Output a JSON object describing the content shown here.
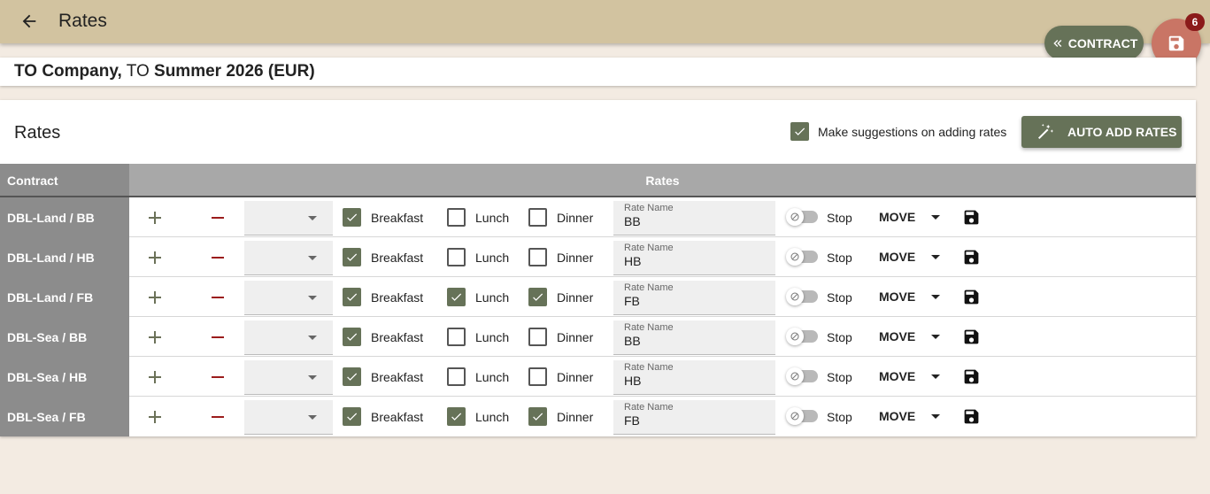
{
  "header": {
    "title": "Rates"
  },
  "fab": {
    "contract_label": "CONTRACT",
    "badge": "6"
  },
  "contract": {
    "company": "TO Company,",
    "prefix": "TO",
    "season": "Summer 2026 (EUR)"
  },
  "rates": {
    "heading": "Rates",
    "suggestions_label": "Make suggestions on adding rates",
    "suggestions_checked": true,
    "auto_add_label": "AUTO ADD RATES",
    "col_contract": "Contract",
    "col_rates": "Rates",
    "meal_labels": {
      "breakfast": "Breakfast",
      "lunch": "Lunch",
      "dinner": "Dinner"
    },
    "rate_name_label": "Rate Name",
    "stop_label": "Stop",
    "move_label": "MOVE",
    "rows": [
      {
        "label": "DBL-Land / BB",
        "breakfast": true,
        "lunch": false,
        "dinner": false,
        "rate_name": "BB",
        "stop": false
      },
      {
        "label": "DBL-Land / HB",
        "breakfast": true,
        "lunch": false,
        "dinner": false,
        "rate_name": "HB",
        "stop": false
      },
      {
        "label": "DBL-Land / FB",
        "breakfast": true,
        "lunch": true,
        "dinner": true,
        "rate_name": "FB",
        "stop": false
      },
      {
        "label": "DBL-Sea / BB",
        "breakfast": true,
        "lunch": false,
        "dinner": false,
        "rate_name": "BB",
        "stop": false
      },
      {
        "label": "DBL-Sea / HB",
        "breakfast": true,
        "lunch": false,
        "dinner": false,
        "rate_name": "HB",
        "stop": false
      },
      {
        "label": "DBL-Sea / FB",
        "breakfast": true,
        "lunch": true,
        "dinner": true,
        "rate_name": "FB",
        "stop": false
      }
    ]
  },
  "icons": {
    "back": "arrow-left-icon",
    "contract": "double-chevron-left-icon",
    "save": "floppy-disk-icon",
    "auto": "magic-wand-icon",
    "plus": "plus-icon",
    "minus": "minus-icon",
    "stop": "block-icon"
  },
  "colors": {
    "accent": "#667258",
    "topbar": "#d2c3a0",
    "fab": "#c97565",
    "badge": "#8b1a1a",
    "minus": "#9b1c1c",
    "background": "#f3ebe2"
  }
}
